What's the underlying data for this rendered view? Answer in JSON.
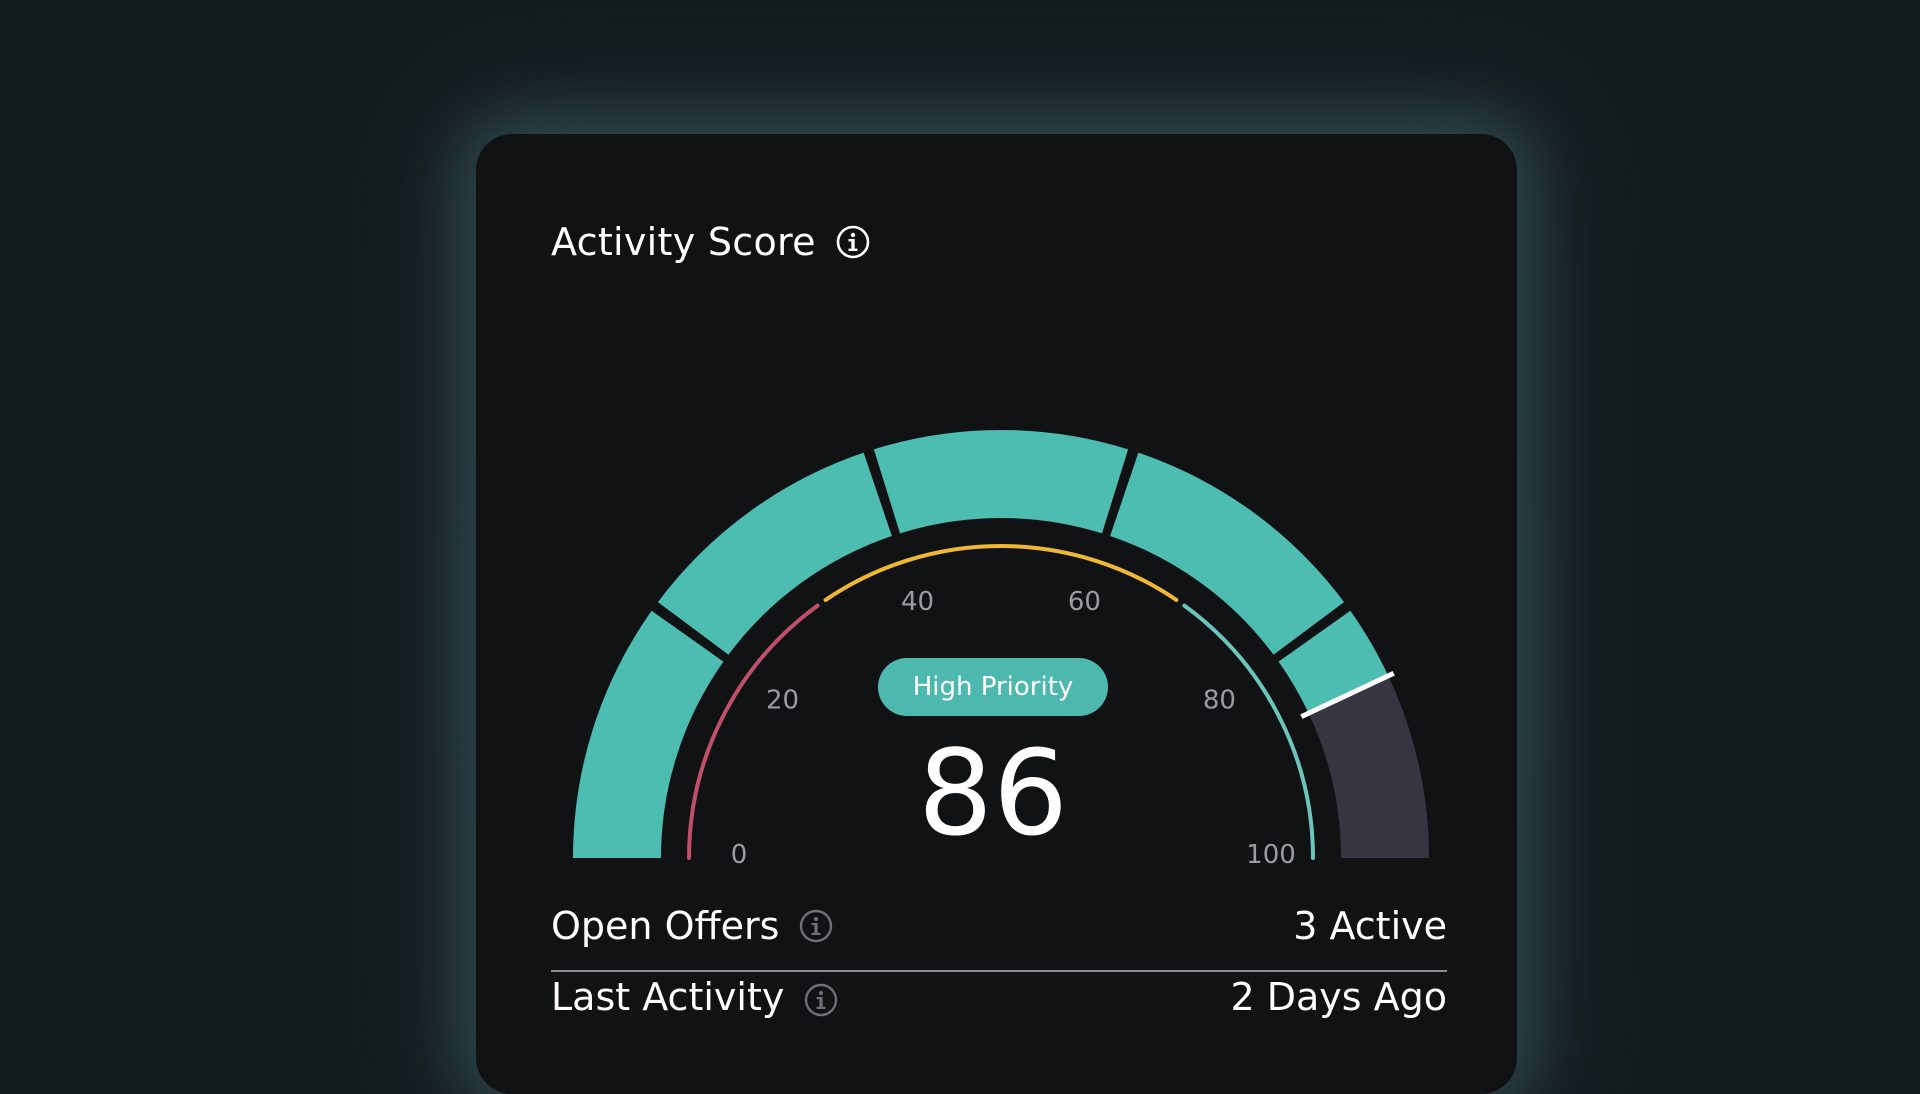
{
  "card": {
    "title": "Activity Score"
  },
  "gauge": {
    "value": 86,
    "min": 0,
    "max": 100,
    "badge": "High Priority",
    "score_text": "86",
    "ticks": [
      "0",
      "20",
      "40",
      "60",
      "80",
      "100"
    ],
    "colors": {
      "filled": "#4dbcb1",
      "empty": "#363640",
      "low_band": "#c0506a",
      "mid_band": "#f0b832",
      "high_band": "#6cc5ba",
      "pointer": "#ffffff"
    }
  },
  "rows": [
    {
      "label": "Open Offers",
      "value": "3 Active"
    },
    {
      "label": "Last Activity",
      "value": "2 Days Ago"
    }
  ]
}
